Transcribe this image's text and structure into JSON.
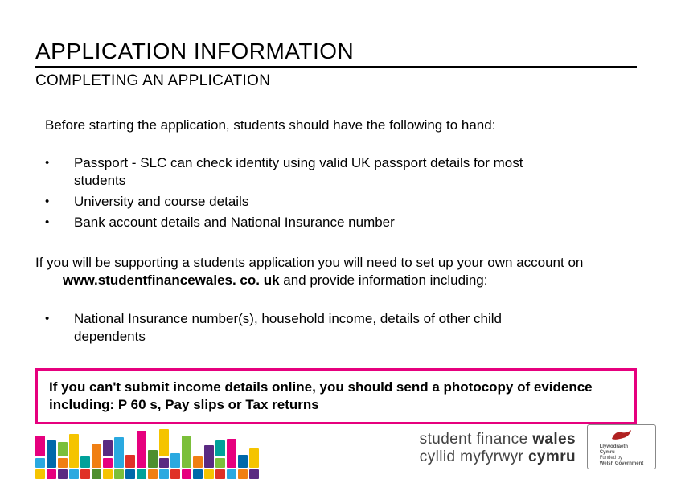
{
  "title": "APPLICATION INFORMATION",
  "subtitle": "COMPLETING AN APPLICATION",
  "intro": "Before starting the application, students should have the following to hand:",
  "bullets1": [
    "Passport - SLC can check identity using valid UK passport details for most students",
    "University and course details",
    "Bank account details and National Insurance number"
  ],
  "para_line1": "If you will be supporting a students application you will need to set up your own account on",
  "para_line2_prefix": "www.studentfinancewales. co. uk",
  "para_line2_suffix": " and provide information including:",
  "bullets2": [
    "National Insurance number(s), household income, details of other child dependents"
  ],
  "callout": "If you can't submit income details online, you should send a photocopy of evidence including: P 60 s, Pay slips or Tax returns",
  "brand": {
    "en_light": "student finance ",
    "en_bold": "wales",
    "cy_light": "cyllid myfyrwyr ",
    "cy_bold": "cymru"
  },
  "gov": {
    "line1": "Llywodraeth",
    "line2": "Cymru",
    "line3": "Funded by",
    "line4": "Welsh Government"
  }
}
